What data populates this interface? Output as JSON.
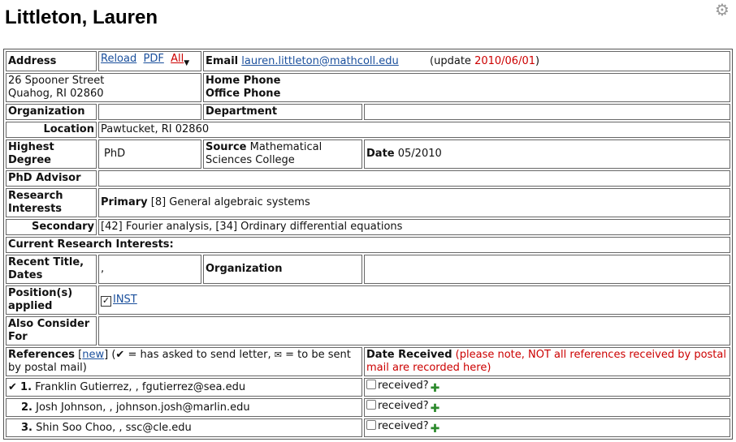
{
  "page_title": "Littleton, Lauren",
  "address": {
    "label": "Address",
    "reload": "Reload",
    "pdf": "PDF",
    "all": "All",
    "line1": "26 Spooner Street",
    "line2": "Quahog, RI 02860"
  },
  "email": {
    "label": "Email",
    "value": "lauren.littleton@mathcoll.edu",
    "update_prefix": "(update",
    "update_date": "2010/06/01",
    "update_suffix": ")"
  },
  "phones": {
    "home_label": "Home Phone",
    "office_label": "Office Phone"
  },
  "organization": {
    "label": "Organization",
    "value": ""
  },
  "department": {
    "label": "Department",
    "value": ""
  },
  "location": {
    "label": "Location",
    "value": "Pawtucket, RI 02860"
  },
  "degree": {
    "label": "Highest Degree",
    "value": "PhD",
    "source_label": "Source",
    "source_value": "Mathematical Sciences College",
    "date_label": "Date",
    "date_value": "05/2010"
  },
  "advisor": {
    "label": "PhD Advisor",
    "value": ""
  },
  "research": {
    "label": "Research Interests",
    "primary_label": "Primary",
    "primary_value": "[8] General algebraic systems",
    "secondary_label": "Secondary",
    "secondary_value": "[42] Fourier analysis, [34] Ordinary differential equations",
    "current_label": "Current Research Interests:"
  },
  "recent_title": {
    "label": "Recent Title, Dates",
    "value": ",",
    "org_label": "Organization"
  },
  "positions": {
    "label": "Position(s) applied",
    "item": "INST"
  },
  "also_consider": {
    "label": "Also Consider For"
  },
  "references": {
    "label": "References",
    "new_link": "new",
    "legend_1": "= has asked to send letter,",
    "legend_2": "= to be sent by postal mail)",
    "date_received_label": "Date Received",
    "note": "(please note, NOT all references received by postal mail are recorded here)",
    "received_label": "received?",
    "items": [
      {
        "num": "1.",
        "text": "Franklin Gutierrez, , fgutierrez@sea.edu",
        "asked": true
      },
      {
        "num": "2.",
        "text": "Josh Johnson, , johnson.josh@marlin.edu",
        "asked": false
      },
      {
        "num": "3.",
        "text": "Shin Soo Choo, , ssc@cle.edu",
        "asked": false
      }
    ]
  }
}
